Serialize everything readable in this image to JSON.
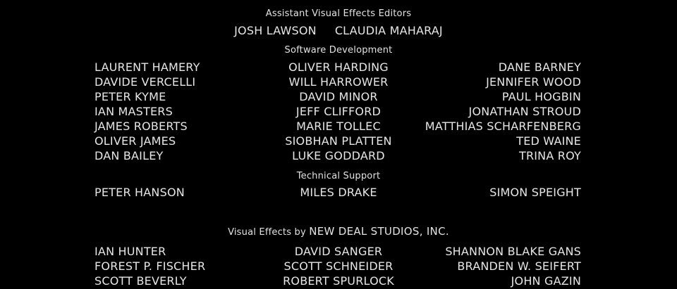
{
  "sections": [
    {
      "heading": "Assistant Visual Effects Editors",
      "names": [
        "JOSH LAWSON",
        "CLAUDIA MAHARAJ"
      ]
    },
    {
      "heading": "Software Development",
      "rows": [
        [
          "LAURENT HAMERY",
          "OLIVER HARDING",
          "DANE BARNEY"
        ],
        [
          "DAVIDE VERCELLI",
          "WILL HARROWER",
          "JENNIFER WOOD"
        ],
        [
          "PETER KYME",
          "DAVID MINOR",
          "PAUL HOGBIN"
        ],
        [
          "IAN MASTERS",
          "JEFF CLIFFORD",
          "JONATHAN STROUD"
        ],
        [
          "JAMES ROBERTS",
          "MARIE TOLLEC",
          "MATTHIAS SCHARFENBERG"
        ],
        [
          "OLIVER JAMES",
          "SIOBHAN PLATTEN",
          "TED WAINE"
        ],
        [
          "DAN BAILEY",
          "LUKE GODDARD",
          "TRINA ROY"
        ]
      ]
    },
    {
      "heading": "Technical Support",
      "rows": [
        [
          "PETER HANSON",
          "MILES DRAKE",
          "SIMON SPEIGHT"
        ]
      ]
    },
    {
      "heading_prefix": "Visual Effects by",
      "heading_studio": "NEW DEAL STUDIOS, INC.",
      "rows": [
        [
          "IAN HUNTER",
          "DAVID SANGER",
          "SHANNON BLAKE GANS"
        ],
        [
          "FOREST P. FISCHER",
          "SCOTT SCHNEIDER",
          "BRANDEN W. SEIFERT"
        ],
        [
          "SCOTT BEVERLY",
          "ROBERT SPURLOCK",
          "JOHN GAZIN"
        ]
      ]
    }
  ]
}
